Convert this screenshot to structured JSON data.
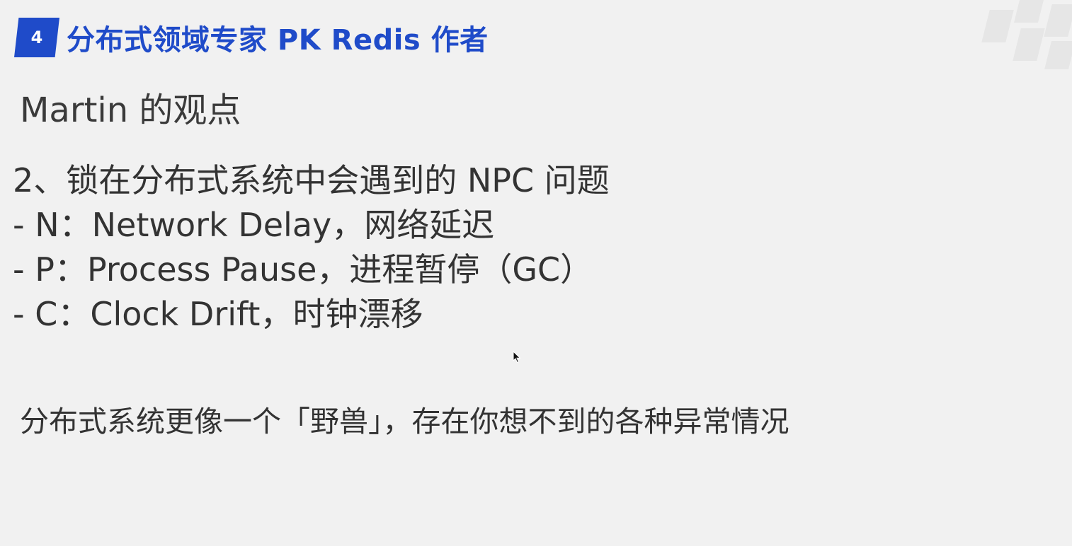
{
  "header": {
    "number": "4",
    "title": "分布式领域专家 PK Redis 作者"
  },
  "subtitle": "Martin 的观点",
  "lines": [
    "2、锁在分布式系统中会遇到的 NPC 问题",
    "- N：Network Delay，网络延迟",
    "- P：Process Pause，进程暂停（GC）",
    "- C：Clock Drift，时钟漂移"
  ],
  "footer": "分布式系统更像一个「野兽」，存在你想不到的各种异常情况",
  "colors": {
    "accent": "#1f4bc9",
    "background": "#f1f1f1",
    "text": "#333333"
  },
  "icons": {
    "cursor": "mouse-cursor-icon"
  }
}
